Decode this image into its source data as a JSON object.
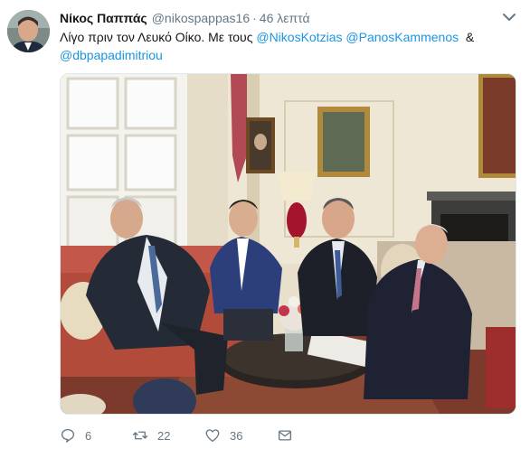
{
  "tweet": {
    "author_name": "Νίκος Παππάς",
    "author_handle": "@nikospappas16",
    "separator": "·",
    "time_ago": "46 λεπτά",
    "text_prefix": "Λίγο πριν τον Λευκό Οίκο. Με τους",
    "mentions": [
      "@NikosKotzias",
      "@PanosKammenos",
      "@dbpapadimitriou"
    ],
    "ampersand": "&",
    "photo_icon": "photo-of-meeting-in-sitting-room"
  },
  "actions": {
    "reply_count": "6",
    "retweet_count": "22",
    "like_count": "36"
  },
  "icons": {
    "caret": "chevron-down-icon",
    "reply": "reply-icon",
    "retweet": "retweet-icon",
    "like": "heart-icon",
    "message": "envelope-icon"
  },
  "colors": {
    "link": "#1b95e0",
    "secondary_text": "#657786",
    "primary_text": "#14171a"
  }
}
